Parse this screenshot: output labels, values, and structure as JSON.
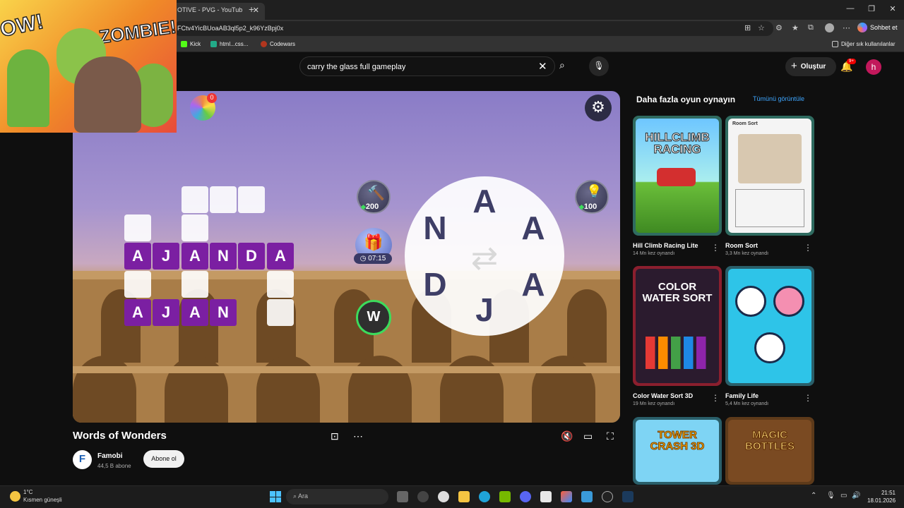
{
  "browser": {
    "tab_title": "OTIVE - PVG - YouTub",
    "url": "FCtv4YicBUoaAB3ql5p2_k96YzBpj0x",
    "copilot_label": "Sohbet et",
    "bookmarks": [
      "Kick",
      "html...css...",
      "Codewars"
    ],
    "other_bookmarks": "Diğer sık kullanılanlar"
  },
  "youtube": {
    "search_value": "carry the glass full gameplay",
    "create_label": "Oluştur",
    "notif_badge": "9+",
    "avatar_letter": "h"
  },
  "game": {
    "board_rows": [
      [
        "A",
        "J",
        "A",
        "N",
        "D",
        "A"
      ],
      [
        "A",
        "J",
        "A",
        "N"
      ]
    ],
    "wheel_letters": [
      "A",
      "N",
      "A",
      "D",
      "A",
      "J"
    ],
    "hammer_cost": "200",
    "hint_cost": "100",
    "gift_timer": "07:15",
    "spin_badge": "0",
    "w_label": "W"
  },
  "video": {
    "title": "Words of Wonders",
    "channel": "Famobi",
    "channel_logo": "F",
    "subscribers": "44,5 B abone",
    "subscribe_label": "Abone ol"
  },
  "sidebar": {
    "title": "Daha fazla oyun oynayın",
    "see_all": "Tümünü görüntüle",
    "games": [
      {
        "title": "Hill Climb Racing Lite",
        "plays": "14 Mn kez oynandı",
        "art": "HILLCLIMB RACING"
      },
      {
        "title": "Room Sort",
        "plays": "3,3 Mn kez oynandı",
        "art": "Room Sort"
      },
      {
        "title": "Color Water Sort 3D",
        "plays": "19 Mn kez oynandı",
        "art": "COLOR WATER SORT"
      },
      {
        "title": "Family Life",
        "plays": "5,4 Mn kez oynandı",
        "art": ""
      },
      {
        "title": "",
        "plays": "",
        "art": "TOWER CRASH 3D"
      },
      {
        "title": "",
        "plays": "",
        "art": "MAGIC BOTTLES"
      }
    ]
  },
  "cam_overlay": {
    "text1": "OW!",
    "text2": "ZOMBIE!"
  },
  "taskbar": {
    "weather_temp": "1°C",
    "weather_desc": "Kısmen güneşli",
    "search_label": "Ara",
    "time": "21:51",
    "date": "18.01.2026"
  }
}
